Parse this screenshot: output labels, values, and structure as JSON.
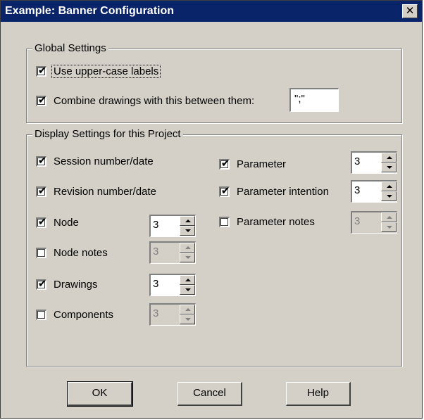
{
  "window": {
    "title": "Example: Banner Configuration",
    "close_glyph": "✕"
  },
  "global": {
    "legend": "Global Settings",
    "uppercase": {
      "label": "Use upper-case labels",
      "checked": true
    },
    "combine": {
      "label": "Combine drawings with this between them:",
      "checked": true,
      "value": "\";\""
    }
  },
  "display": {
    "legend": "Display Settings for this Project",
    "session": {
      "label": "Session number/date",
      "checked": true
    },
    "revision": {
      "label": "Revision number/date",
      "checked": true
    },
    "node": {
      "label": "Node",
      "checked": true,
      "value": "3"
    },
    "node_notes": {
      "label": "Node notes",
      "checked": false,
      "value": "3"
    },
    "drawings": {
      "label": "Drawings",
      "checked": true,
      "value": "3"
    },
    "components": {
      "label": "Components",
      "checked": false,
      "value": "3"
    },
    "parameter": {
      "label": "Parameter",
      "checked": true,
      "value": "3"
    },
    "parameter_intention": {
      "label": "Parameter intention",
      "checked": true,
      "value": "3"
    },
    "parameter_notes": {
      "label": "Parameter notes",
      "checked": false,
      "value": "3"
    }
  },
  "buttons": {
    "ok": "OK",
    "cancel": "Cancel",
    "help": "Help"
  },
  "check_glyph": "✔"
}
